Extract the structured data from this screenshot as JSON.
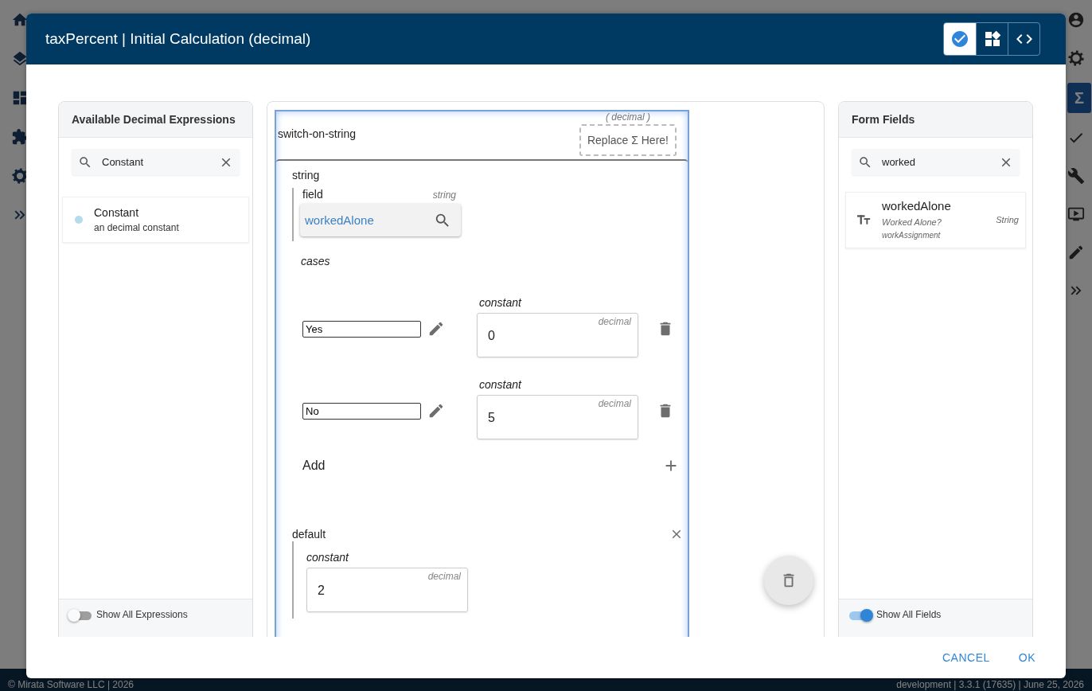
{
  "app": {
    "rail_badge": "Σ",
    "footer_left": "© Mirata Software LLC | 2026",
    "footer_right": "development | 3.3.1 (17635) | June 25, 2026"
  },
  "dialog": {
    "title": "taxPercent | Initial Calculation (decimal)",
    "view_modes": [
      {
        "kind": "visual",
        "selected": true
      },
      {
        "kind": "blocks",
        "selected": false
      },
      {
        "kind": "code",
        "selected": false
      }
    ]
  },
  "expressions_panel": {
    "title": "Available Decimal Expressions",
    "search": {
      "value": "Constant"
    },
    "items": [
      {
        "name": "Constant",
        "description": "an decimal constant",
        "color": "#b3dcef"
      }
    ],
    "toggle": {
      "label": "Show All Expressions",
      "on": false
    }
  },
  "editor": {
    "type_hint": "( decimal )",
    "drop_target": "Replace Σ Here!",
    "block": "switch-on-string",
    "string_label": "string",
    "field": {
      "label": "field",
      "type": "string",
      "value": "workedAlone"
    },
    "cases_label": "cases",
    "cases": [
      {
        "match": "Yes",
        "value_label": "constant",
        "type": "decimal",
        "value": "0"
      },
      {
        "match": "No",
        "value_label": "constant",
        "type": "decimal",
        "value": "5"
      }
    ],
    "add_label": "Add",
    "default": {
      "label": "default",
      "value_label": "constant",
      "type": "decimal",
      "value": "2"
    }
  },
  "fields_panel": {
    "title": "Form Fields",
    "search": {
      "value": "worked"
    },
    "items": [
      {
        "name": "workedAlone",
        "label": "Worked Alone?",
        "group": "workAssignment",
        "type": "String"
      }
    ],
    "toggle": {
      "label": "Show All Fields",
      "on": true
    }
  },
  "actions": [
    "CANCEL",
    "OK"
  ]
}
